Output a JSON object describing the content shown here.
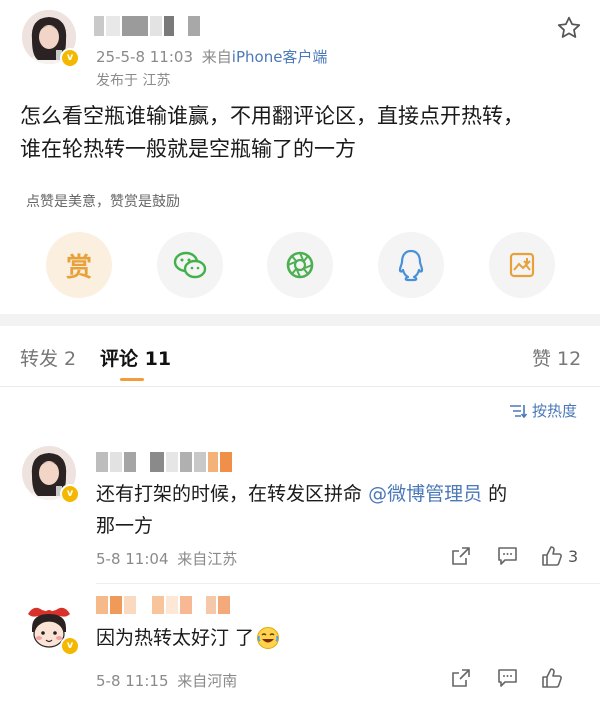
{
  "post": {
    "time": "25-5-8 11:03",
    "source_prefix": "来自",
    "source_device": "iPhone客户端",
    "location": "发布于 江苏",
    "content_line1": "怎么看空瓶谁输谁赢，不用翻评论区，直接点开热转，",
    "content_line2": "谁在轮热转一般就是空瓶输了的一方",
    "reward_hint": "点赞是美意，赞赏是鼓励",
    "reward_label": "赏"
  },
  "tabs": {
    "repost": "转发 2",
    "comment": "评论 11",
    "like": "赞 12"
  },
  "sort": {
    "label": "按热度"
  },
  "comments": [
    {
      "text_line1_before": "还有打架的时候，在转发区拼命",
      "mention": "@微博管理员",
      "text_line1_after": "的",
      "text_line2": "那一方",
      "time": "5-8 11:04",
      "source": "来自江苏",
      "like_count": "3"
    },
    {
      "text_before": "因为热转太好汀",
      "text_after": "了",
      "time": "5-8 11:15",
      "source": "来自河南"
    }
  ],
  "colors": {
    "badge": "#f5b800",
    "link": "#4a78b8",
    "reward": "#e8a13a",
    "wechat": "#43b04a",
    "moments": "#4caf50",
    "qq": "#4a90d9",
    "image": "#e8a13a"
  },
  "icons": [
    "star-icon",
    "wechat-icon",
    "moments-icon",
    "qq-icon",
    "save-image-icon",
    "sort-icon",
    "share-icon",
    "comment-icon",
    "like-icon",
    "laugh-emoji-icon"
  ]
}
